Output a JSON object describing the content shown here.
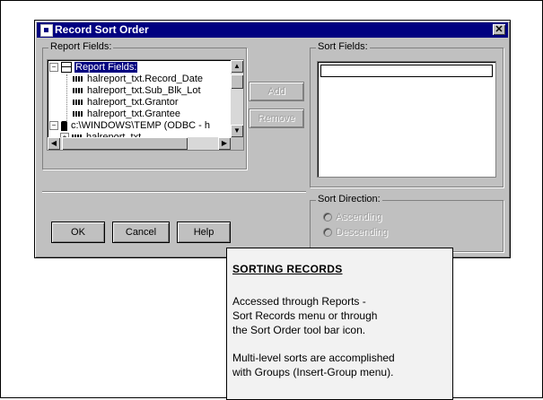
{
  "dialog": {
    "title": "Record Sort Order",
    "close_glyph": "✕"
  },
  "report_fields": {
    "group_label": "Report Fields:",
    "tree": [
      {
        "label": "Report Fields:",
        "toggle": "−",
        "icon": "report-icon",
        "selected": true
      },
      {
        "label": "halreport_txt.Record_Date",
        "icon": "field-icon"
      },
      {
        "label": "halreport_txt.Sub_Blk_Lot",
        "icon": "field-icon"
      },
      {
        "label": "halreport_txt.Grantor",
        "icon": "field-icon"
      },
      {
        "label": "halreport_txt.Grantee",
        "icon": "field-icon"
      },
      {
        "label": "c:\\WINDOWS\\TEMP (ODBC - h",
        "toggle": "−",
        "icon": "database-icon"
      },
      {
        "label": "halreport_txt",
        "icon": "field-icon"
      }
    ]
  },
  "buttons": {
    "add": "Add",
    "remove": "Remove",
    "ok": "OK",
    "cancel": "Cancel",
    "help": "Help"
  },
  "sort_fields": {
    "group_label": "Sort Fields:",
    "value": ""
  },
  "sort_direction": {
    "group_label": "Sort Direction:",
    "ascending": "Ascending",
    "descending": "Descending"
  },
  "info": {
    "heading": "SORTING RECORDS",
    "paragraph1": "Accessed through Reports -\nSort Records menu or through\nthe Sort Order tool bar icon.",
    "paragraph2": "Multi-level sorts are accomplished\nwith Groups (Insert-Group menu)."
  }
}
